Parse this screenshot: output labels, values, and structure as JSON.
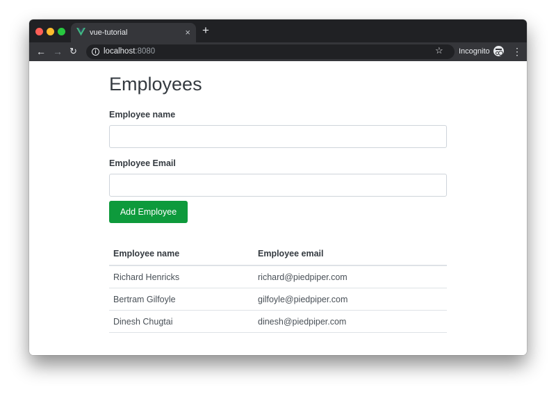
{
  "browser": {
    "tab": {
      "title": "vue-tutorial",
      "favicon": "vue-logo-icon",
      "close_label": "×"
    },
    "new_tab_label": "+",
    "nav": {
      "back": "←",
      "forward": "→",
      "reload": "↻"
    },
    "address": {
      "info_icon": "i",
      "host": "localhost",
      "port": ":8080"
    },
    "bookmark_icon": "☆",
    "incognito_label": "Incognito",
    "menu_icon": "⋮",
    "colors": {
      "tabstrip": "#202124",
      "toolbar": "#35363a",
      "close": "#fe5f57",
      "minimize": "#febc2e",
      "maximize": "#28c840"
    }
  },
  "page": {
    "title": "Employees",
    "form": {
      "name_label": "Employee name",
      "name_value": "",
      "name_placeholder": "",
      "email_label": "Employee Email",
      "email_value": "",
      "email_placeholder": "",
      "submit_label": "Add Employee",
      "submit_color": "#0e9a3c"
    },
    "table": {
      "headers": [
        "Employee name",
        "Employee email"
      ],
      "rows": [
        {
          "name": "Richard Henricks",
          "email": "richard@piedpiper.com"
        },
        {
          "name": "Bertram Gilfoyle",
          "email": "gilfoyle@piedpiper.com"
        },
        {
          "name": "Dinesh Chugtai",
          "email": "dinesh@piedpiper.com"
        }
      ]
    }
  }
}
